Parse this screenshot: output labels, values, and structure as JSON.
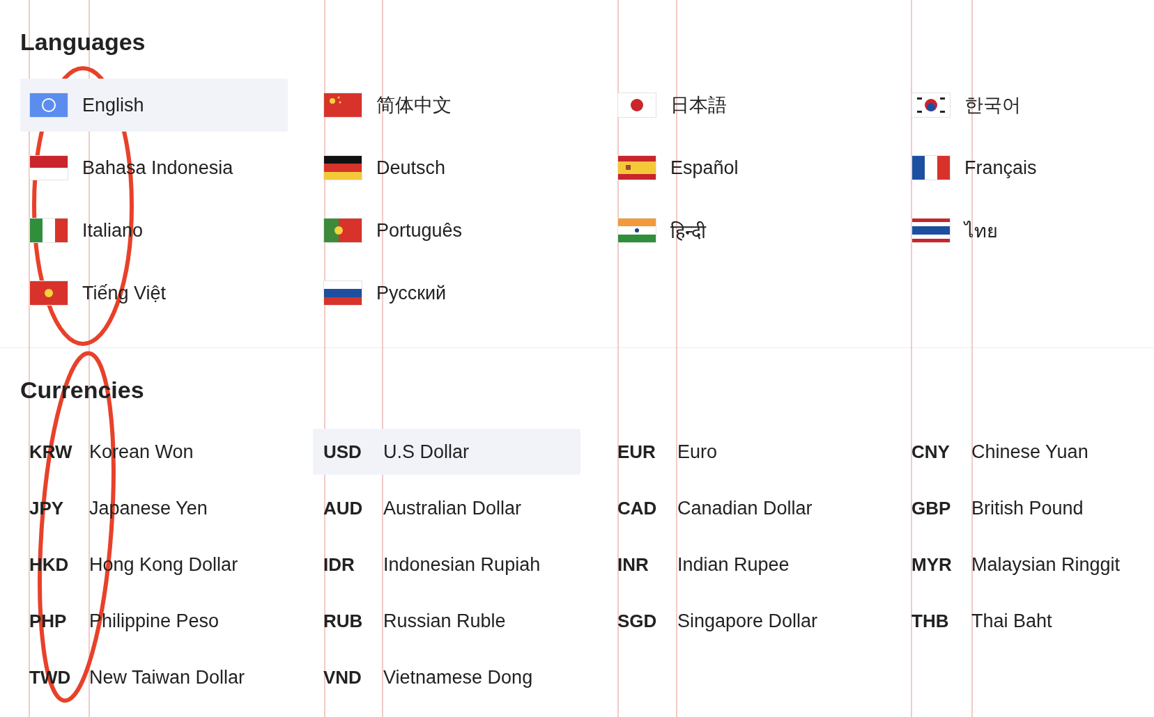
{
  "languages": {
    "title": "Languages",
    "items": [
      {
        "label": "English",
        "selected": true
      },
      {
        "label": "简体中文",
        "selected": false
      },
      {
        "label": "日本語",
        "selected": false
      },
      {
        "label": "한국어",
        "selected": false
      },
      {
        "label": "Bahasa Indonesia",
        "selected": false
      },
      {
        "label": "Deutsch",
        "selected": false
      },
      {
        "label": "Español",
        "selected": false
      },
      {
        "label": "Français",
        "selected": false
      },
      {
        "label": "Italiano",
        "selected": false
      },
      {
        "label": "Português",
        "selected": false
      },
      {
        "label": "हिन्दी",
        "selected": false
      },
      {
        "label": "ไทย",
        "selected": false
      },
      {
        "label": "Tiếng Việt",
        "selected": false
      },
      {
        "label": "Русский",
        "selected": false
      }
    ]
  },
  "currencies": {
    "title": "Currencies",
    "items": [
      {
        "code": "KRW",
        "name": "Korean Won",
        "selected": false
      },
      {
        "code": "USD",
        "name": "U.S Dollar",
        "selected": true
      },
      {
        "code": "EUR",
        "name": "Euro",
        "selected": false
      },
      {
        "code": "CNY",
        "name": "Chinese Yuan",
        "selected": false
      },
      {
        "code": "JPY",
        "name": "Japanese Yen",
        "selected": false
      },
      {
        "code": "AUD",
        "name": "Australian Dollar",
        "selected": false
      },
      {
        "code": "CAD",
        "name": "Canadian Dollar",
        "selected": false
      },
      {
        "code": "GBP",
        "name": "British Pound",
        "selected": false
      },
      {
        "code": "HKD",
        "name": "Hong Kong Dollar",
        "selected": false
      },
      {
        "code": "IDR",
        "name": "Indonesian Rupiah",
        "selected": false
      },
      {
        "code": "INR",
        "name": "Indian Rupee",
        "selected": false
      },
      {
        "code": "MYR",
        "name": "Malaysian Ringgit",
        "selected": false
      },
      {
        "code": "PHP",
        "name": "Philippine Peso",
        "selected": false
      },
      {
        "code": "RUB",
        "name": "Russian Ruble",
        "selected": false
      },
      {
        "code": "SGD",
        "name": "Singapore Dollar",
        "selected": false
      },
      {
        "code": "THB",
        "name": "Thai Baht",
        "selected": false
      },
      {
        "code": "TWD",
        "name": "New Taiwan Dollar",
        "selected": false
      },
      {
        "code": "VND",
        "name": "Vietnamese Dong",
        "selected": false
      }
    ]
  }
}
